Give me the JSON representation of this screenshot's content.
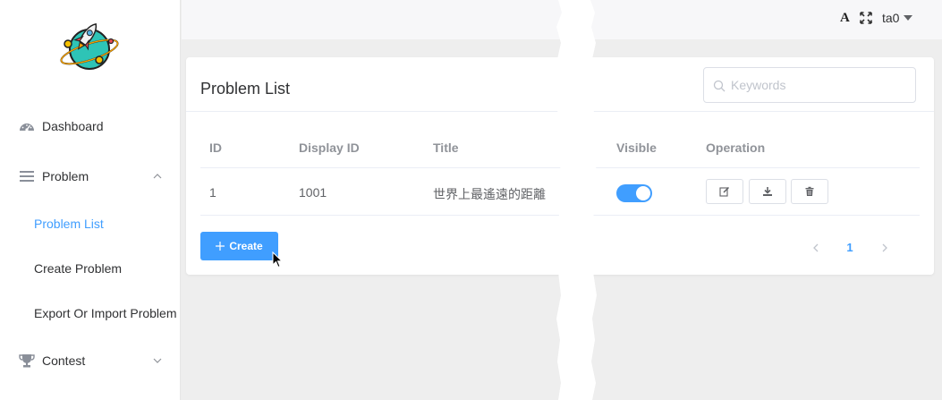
{
  "sidebar": {
    "items": [
      {
        "label": "Dashboard",
        "icon": "dashboard-icon"
      },
      {
        "label": "Problem",
        "icon": "menu-lines-icon",
        "expanded": true
      },
      {
        "label": "Contest",
        "icon": "trophy-icon",
        "expanded": false
      }
    ],
    "problem_submenu": [
      {
        "label": "Problem List",
        "active": true
      },
      {
        "label": "Create Problem",
        "active": false
      },
      {
        "label": "Export Or Import Problem",
        "active": false
      }
    ]
  },
  "header": {
    "font_glyph": "A",
    "username": "ta0"
  },
  "card": {
    "title": "Problem List",
    "search_placeholder": "Keywords",
    "columns": [
      "ID",
      "Display ID",
      "Title",
      "Visible",
      "Operation"
    ],
    "rows": [
      {
        "id": "1",
        "display_id": "1001",
        "title": "世界上最遙遠的距離",
        "visible": true
      }
    ],
    "create_label": "Create",
    "current_page": "1"
  },
  "colors": {
    "accent": "#409eff",
    "sidebar_bg": "#ffffff",
    "page_bg": "#eeeeee"
  }
}
